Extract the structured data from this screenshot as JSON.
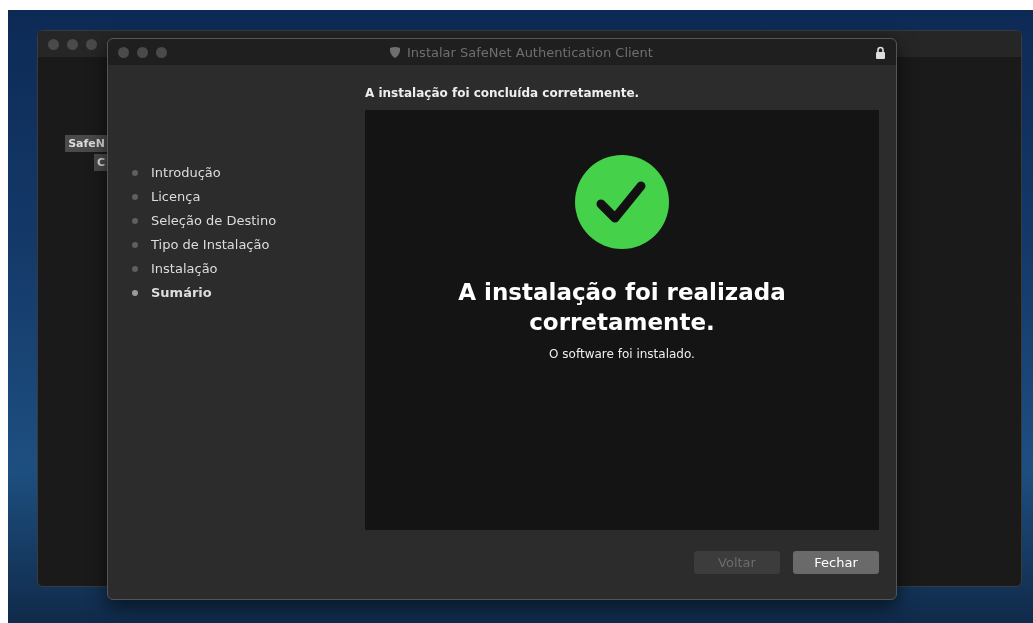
{
  "back_window": {
    "labels": [
      "SafeN",
      "C"
    ]
  },
  "window": {
    "title": "Instalar SafeNet Authentication Client"
  },
  "steps": [
    {
      "label": "Introdução",
      "selected": false
    },
    {
      "label": "Licença",
      "selected": false
    },
    {
      "label": "Seleção de Destino",
      "selected": false
    },
    {
      "label": "Tipo de Instalação",
      "selected": false
    },
    {
      "label": "Instalação",
      "selected": false
    },
    {
      "label": "Sumário",
      "selected": true
    }
  ],
  "heading": "A instalação foi concluída corretamente.",
  "panel": {
    "title": "A instalação foi realizada corretamente.",
    "message": "O software foi instalado."
  },
  "buttons": [
    {
      "label": "Voltar",
      "disabled": true
    },
    {
      "label": "Fechar",
      "disabled": false
    }
  ]
}
